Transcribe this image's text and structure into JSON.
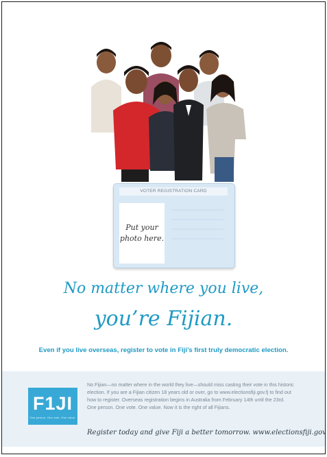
{
  "card": {
    "header": "VOTER REGISTRATION CARD",
    "photo_placeholder": "Put your\nphoto here."
  },
  "headline": {
    "line1": "No matter where you live,",
    "line2": "you’re Fijian."
  },
  "subline": "Even if you live overseas, register to vote in Fiji’s first truly democratic election.",
  "footer": {
    "logo_text": "F1JI",
    "logo_tagline": "One person. One vote. One value.",
    "body_lines": [
      "No Fijian—no matter where in the world they live—should miss casting their vote in this historic",
      "election. If you are a Fijian citizen 18 years old or over, go to www.electionsfiji.gov.fj to find out",
      "how to register. Overseas registration begins in Australia from February 14th until the 23rd.",
      "One person. One vote. One value. Now it is the right of all Fijians."
    ],
    "cta": "Register today and give Fiji a better tomorrow. www.electionsfiji.gov.fj"
  },
  "colors": {
    "accent": "#1e9ac4",
    "logo_bg": "#38a9d6",
    "card_bg": "#d9e8f5",
    "footer_bg": "#e9f1f7"
  }
}
